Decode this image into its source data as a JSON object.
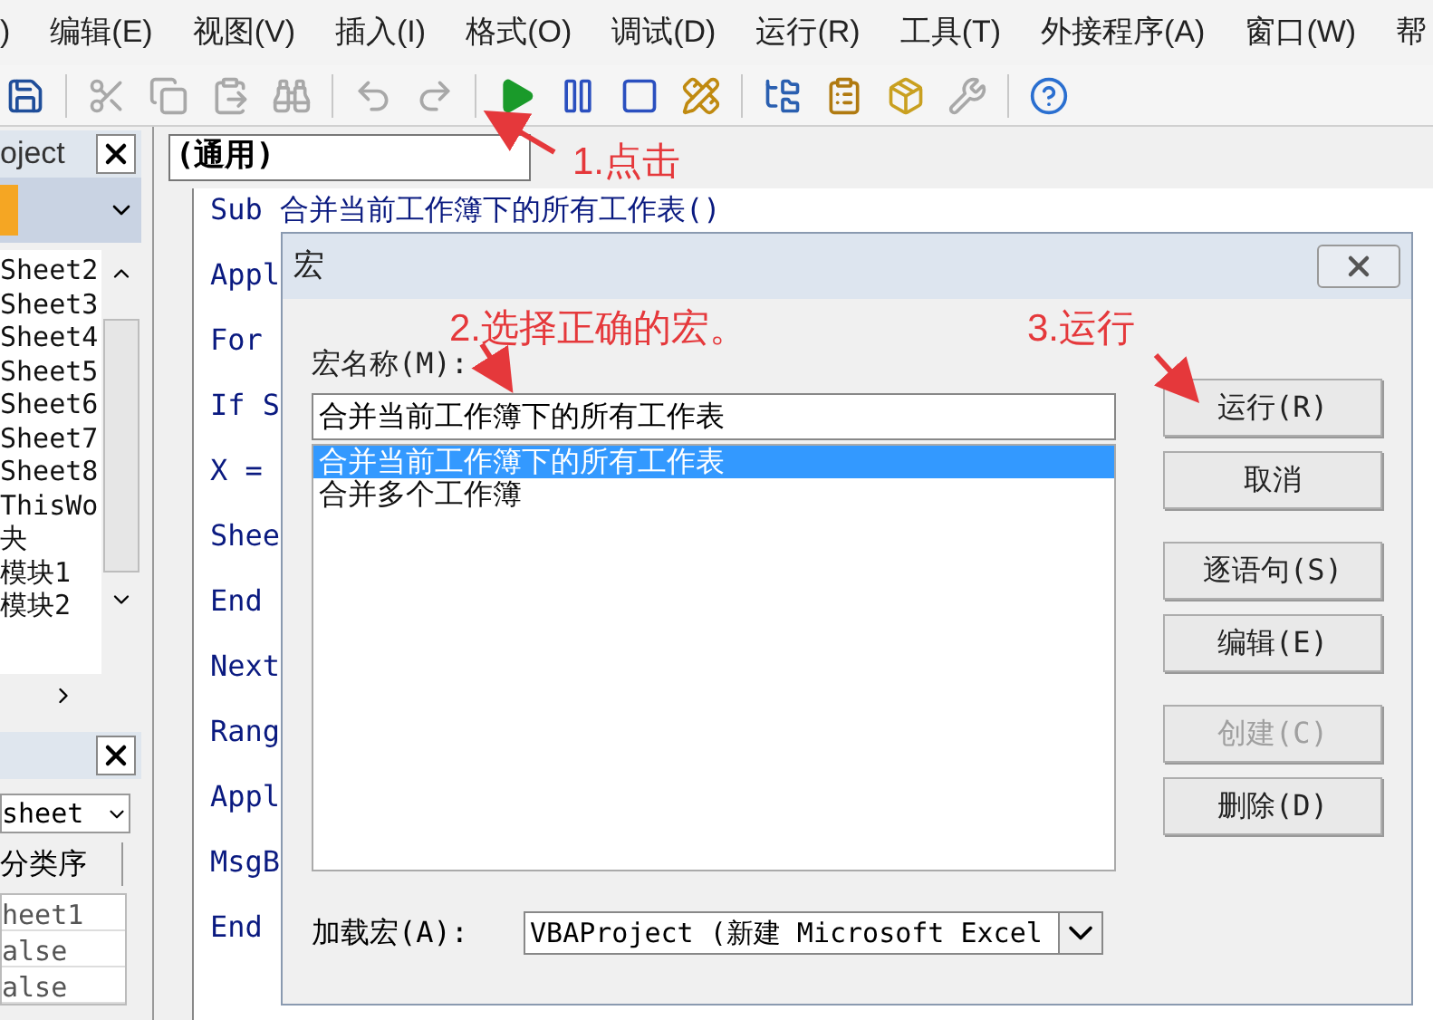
{
  "menu_bar": [
    {
      "label": ")"
    },
    {
      "label": "编辑(E)"
    },
    {
      "label": "视图(V)"
    },
    {
      "label": "插入(I)"
    },
    {
      "label": "格式(O)"
    },
    {
      "label": "调试(D)"
    },
    {
      "label": "运行(R)"
    },
    {
      "label": "工具(T)"
    },
    {
      "label": "外接程序(A)"
    },
    {
      "label": "窗口(W)"
    },
    {
      "label": "帮"
    }
  ],
  "toolbar": [
    {
      "kind": "save",
      "disabled": false
    },
    {
      "kind": "sep"
    },
    {
      "kind": "cut",
      "disabled": true
    },
    {
      "kind": "copy",
      "disabled": true
    },
    {
      "kind": "paste",
      "disabled": true
    },
    {
      "kind": "find",
      "disabled": true
    },
    {
      "kind": "sep"
    },
    {
      "kind": "undo",
      "disabled": true
    },
    {
      "kind": "redo",
      "disabled": true
    },
    {
      "kind": "sep"
    },
    {
      "kind": "run",
      "disabled": false
    },
    {
      "kind": "pause",
      "disabled": false
    },
    {
      "kind": "stop",
      "disabled": false
    },
    {
      "kind": "design",
      "disabled": false
    },
    {
      "kind": "sep"
    },
    {
      "kind": "project",
      "disabled": false
    },
    {
      "kind": "properties",
      "disabled": false
    },
    {
      "kind": "browser",
      "disabled": false
    },
    {
      "kind": "tools",
      "disabled": true
    },
    {
      "kind": "sep"
    },
    {
      "kind": "help",
      "disabled": false
    }
  ],
  "project_panel": {
    "title": "oject",
    "items": [
      "Sheet2",
      "Sheet3",
      "Sheet4",
      "Sheet5",
      "Sheet6",
      "Sheet7",
      "Sheet8",
      "ThisWo",
      "夬",
      "模块1",
      "模块2"
    ]
  },
  "properties_panel": {
    "object": "sheet",
    "tab": "分类序",
    "rows": [
      "heet1",
      "alse",
      "alse"
    ]
  },
  "code_window": {
    "object_dropdown": "(通用)",
    "lines": [
      "Sub 合并当前工作簿下的所有工作表()",
      "Appl",
      "For",
      "If S",
      "X =",
      "Shee",
      "End",
      "Next",
      "Rang",
      "Appl",
      "MsgB",
      "End"
    ]
  },
  "dialog": {
    "title": "宏",
    "name_label": "宏名称(M):",
    "name_value": "合并当前工作簿下的所有工作表",
    "macros": [
      {
        "label": "合并当前工作簿下的所有工作表",
        "selected": true
      },
      {
        "label": "合并多个工作簿",
        "selected": false
      }
    ],
    "button_groups": [
      [
        {
          "label": "运行(R)",
          "disabled": false
        },
        {
          "label": "取消",
          "disabled": false
        }
      ],
      [
        {
          "label": "逐语句(S)",
          "disabled": false
        },
        {
          "label": "编辑(E)",
          "disabled": false
        }
      ],
      [
        {
          "label": "创建(C)",
          "disabled": true
        },
        {
          "label": "删除(D)",
          "disabled": false
        }
      ]
    ],
    "macros_in_label": "加载宏(A):",
    "macros_in_value": "VBAProject (新建 Microsoft Excel"
  },
  "annotations": [
    "1.点击",
    "2.选择正确的宏。",
    "3.运行"
  ]
}
